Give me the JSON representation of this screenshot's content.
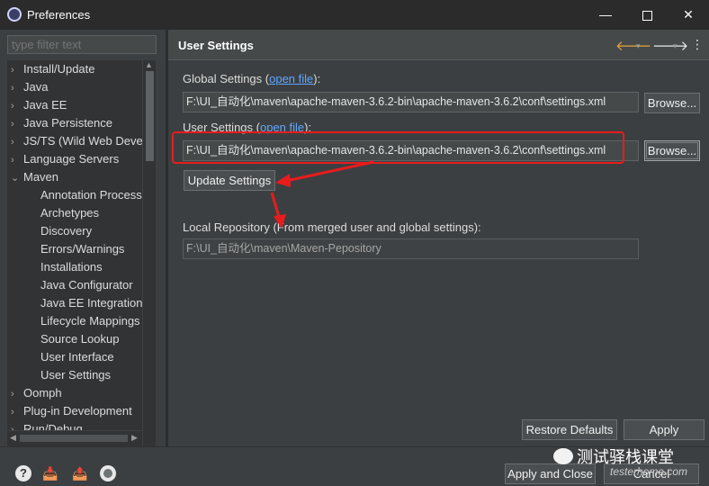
{
  "window": {
    "title": "Preferences",
    "minimize": "—",
    "close": "✕"
  },
  "sidebar": {
    "filter_placeholder": "type filter text",
    "items": [
      {
        "label": "Install/Update",
        "chevron": "›"
      },
      {
        "label": "Java",
        "chevron": "›"
      },
      {
        "label": "Java EE",
        "chevron": "›"
      },
      {
        "label": "Java Persistence",
        "chevron": "›"
      },
      {
        "label": "JS/TS (Wild Web Deve",
        "chevron": "›"
      },
      {
        "label": "Language Servers",
        "chevron": "›"
      },
      {
        "label": "Maven",
        "chevron": "⌄"
      },
      {
        "label": "Annotation Process"
      },
      {
        "label": "Archetypes"
      },
      {
        "label": "Discovery"
      },
      {
        "label": "Errors/Warnings"
      },
      {
        "label": "Installations"
      },
      {
        "label": "Java Configurator"
      },
      {
        "label": "Java EE Integration"
      },
      {
        "label": "Lifecycle Mappings"
      },
      {
        "label": "Source Lookup"
      },
      {
        "label": "User Interface"
      },
      {
        "label": "User Settings"
      },
      {
        "label": "Oomph",
        "chevron": "›"
      },
      {
        "label": "Plug-in Development",
        "chevron": "›"
      },
      {
        "label": "Run/Debug",
        "chevron": "›"
      }
    ]
  },
  "page": {
    "title": "User Settings",
    "back_icon": "🡐",
    "forward_icon": "🡒",
    "dropdown": "▾",
    "more": "⋮",
    "global_label_prefix": "Global Settings (",
    "global_label_link": "open file",
    "global_label_suffix": "):",
    "global_path": "F:\\UI_自动化\\maven\\apache-maven-3.6.2-bin\\apache-maven-3.6.2\\conf\\settings.xml",
    "user_label_prefix": "User Settings (",
    "user_label_link": "open file",
    "user_label_suffix": "):",
    "user_path": "F:\\UI_自动化\\maven\\apache-maven-3.6.2-bin\\apache-maven-3.6.2\\conf\\settings.xml",
    "browse": "Browse...",
    "update_settings": "Update Settings",
    "local_repo_label": "Local Repository (From merged user and global settings):",
    "local_repo_path": "F:\\UI_自动化\\maven\\Maven-Pepository",
    "restore_defaults": "Restore Defaults",
    "apply": "Apply"
  },
  "footer": {
    "apply_and_close": "Apply and Close",
    "cancel": "Cancel",
    "watermark": "测试驿栈课堂",
    "watermark_sub": "testerhome.com"
  },
  "colors": {
    "annotation": "#e81c1c",
    "link": "#5fa8ff"
  }
}
